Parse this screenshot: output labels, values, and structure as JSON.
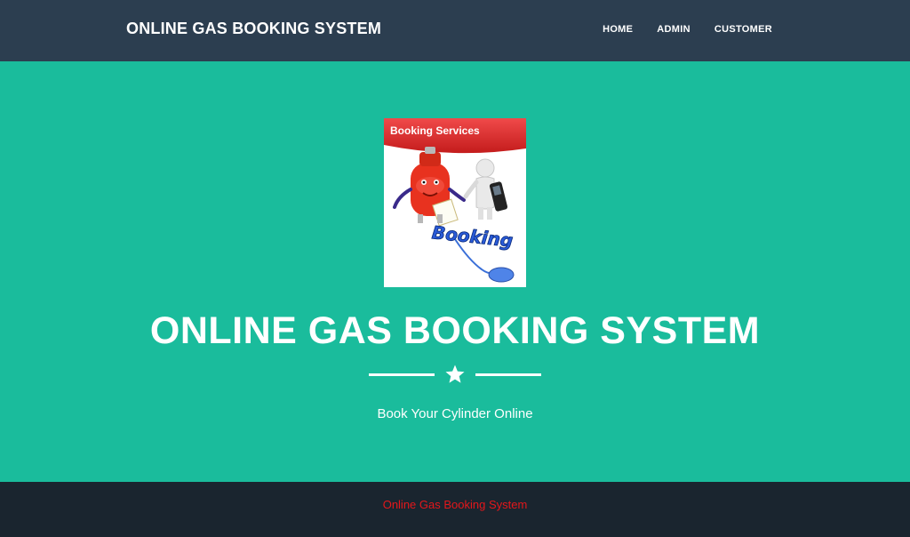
{
  "navbar": {
    "brand": "ONLINE GAS BOOKING SYSTEM",
    "links": [
      "HOME",
      "ADMIN",
      "CUSTOMER"
    ]
  },
  "masthead": {
    "logo": {
      "banner_text": "Booking Services",
      "word": "Booking"
    },
    "title": "ONLINE GAS BOOKING SYSTEM",
    "subtitle": "Book Your Cylinder Online"
  },
  "footer": {
    "text": "Online Gas Booking System"
  },
  "colors": {
    "navbar_bg": "#2c3e50",
    "masthead_bg": "#1abc9c",
    "footer_bg": "#1a252f",
    "footer_text": "#e4171b",
    "logo_banner": "#e32b2b"
  },
  "icons": {
    "divider": "star-icon"
  }
}
